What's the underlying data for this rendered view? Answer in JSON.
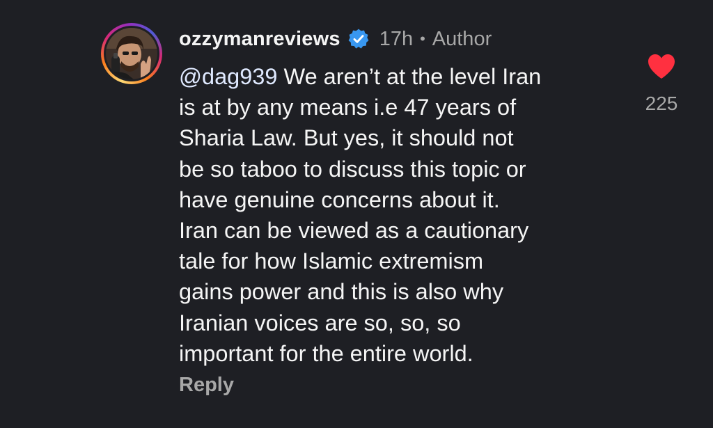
{
  "comment": {
    "username": "ozzymanreviews",
    "verified_icon": "verified-badge-icon",
    "time": "17h",
    "separator": "•",
    "role": "Author",
    "mention": "@dag939",
    "lines": [
      " We aren’t at the level Iran",
      "is at by any means i.e 47 years of",
      "Sharia Law. But yes, it should not",
      "be so taboo to discuss this topic or",
      "have genuine concerns about it.",
      "Iran can be viewed as a cautionary",
      "tale for how Islamic extremism",
      "gains power and this is also why",
      "Iranian voices are so, so, so",
      "important for the entire world."
    ],
    "reply_label": "Reply",
    "like_count": "225",
    "colors": {
      "background": "#1e1f24",
      "verified": "#3897f0",
      "heart": "#ff3040",
      "muted": "#a8a8a8"
    }
  }
}
